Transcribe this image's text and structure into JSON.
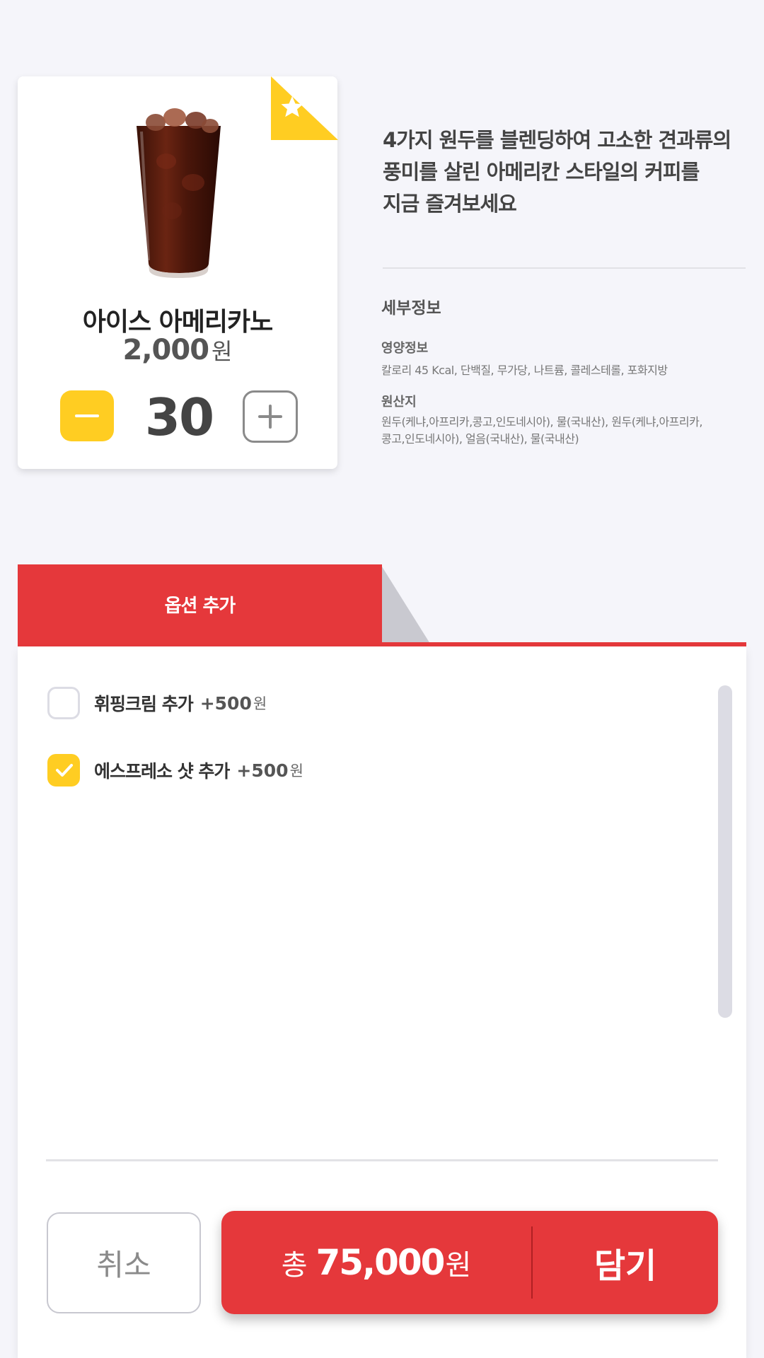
{
  "product": {
    "name": "아이스 아메리카노",
    "price": "2,000",
    "price_unit": "원",
    "quantity": "30",
    "badge_icon": "star-icon",
    "badge_color": "#ffcd22"
  },
  "description": {
    "lines": [
      "4가지 원두를 블렌딩하여 고소한 견과류의",
      "풍미를 살린 아메리칸 스타일의 커피를",
      "지금 즐겨보세요"
    ]
  },
  "details": {
    "title": "세부정보",
    "nutrition_label": "영양정보",
    "nutrition_text": "칼로리 45 Kcal, 단백질, 무가당, 나트륨, 콜레스테롤, 포화지방",
    "origin_label": "원산지",
    "origin_lines": [
      "원두(케냐,아프리카,콩고,인도네시아), 물(국내산),  원두(케냐,아프리카,",
      "콩고,인도네시아), 얼음(국내산), 물(국내산)"
    ]
  },
  "options": {
    "tab_label": "옵션 추가",
    "items": [
      {
        "label": "휘핑크림 추가",
        "price": "+500",
        "unit": "원",
        "checked": false
      },
      {
        "label": "에스프레소 샷 추가",
        "price": "+500",
        "unit": "원",
        "checked": true
      }
    ]
  },
  "footer": {
    "cancel_label": "취소",
    "total_prefix": "총",
    "total_amount": "75,000",
    "total_unit": "원",
    "add_label": "담기"
  },
  "colors": {
    "accent": "#e5383b",
    "highlight": "#ffcd22",
    "background": "#f5f5fa"
  }
}
